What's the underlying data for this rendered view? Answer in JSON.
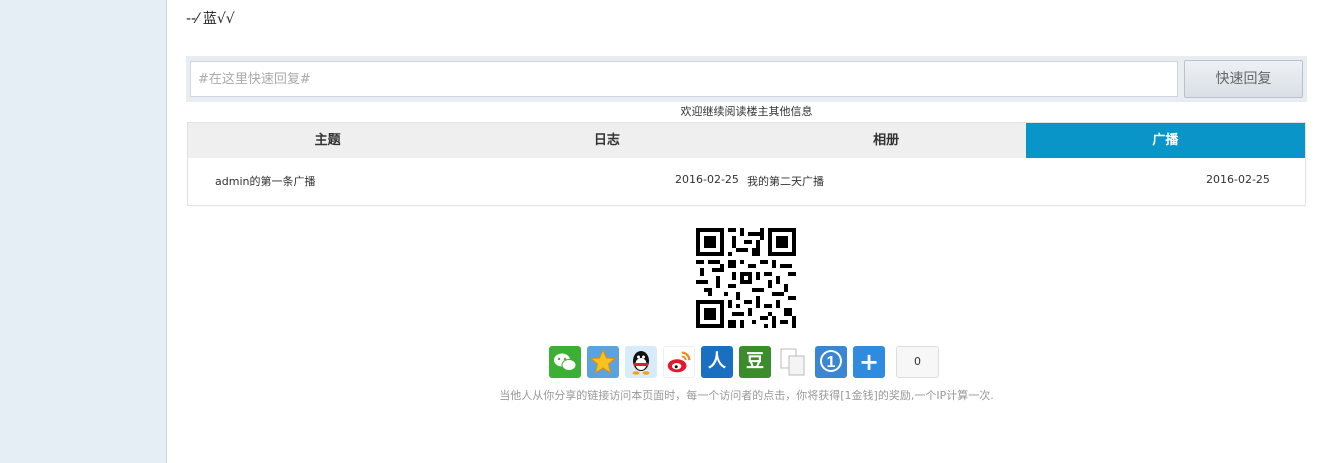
{
  "post": {
    "content": "--⁄ 蓝√√"
  },
  "reply": {
    "placeholder": "#在这里快速回复#",
    "button_label": "快速回复"
  },
  "more": {
    "title": "欢迎继续阅读楼主其他信息",
    "tabs": [
      {
        "label": "主题",
        "active": false
      },
      {
        "label": "日志",
        "active": false
      },
      {
        "label": "相册",
        "active": false
      },
      {
        "label": "广播",
        "active": true
      }
    ],
    "items": [
      {
        "title": "admin的第一条广播",
        "date": "2016-02-25"
      },
      {
        "title": "我的第二天广播",
        "date": "2016-02-25"
      }
    ]
  },
  "share": {
    "icons": [
      "wechat-icon",
      "qzone-icon",
      "qq-icon",
      "weibo-icon",
      "renren-icon",
      "douban-icon",
      "copy-icon",
      "info-icon",
      "more-icon"
    ],
    "count": "0",
    "note": "当他人从你分享的链接访问本页面时，每一个访问者的点击，你将获得[1金钱]的奖励,一个IP计算一次."
  },
  "colors": {
    "active_tab": "#0a95c9",
    "sidebar": "#e5edf5"
  }
}
